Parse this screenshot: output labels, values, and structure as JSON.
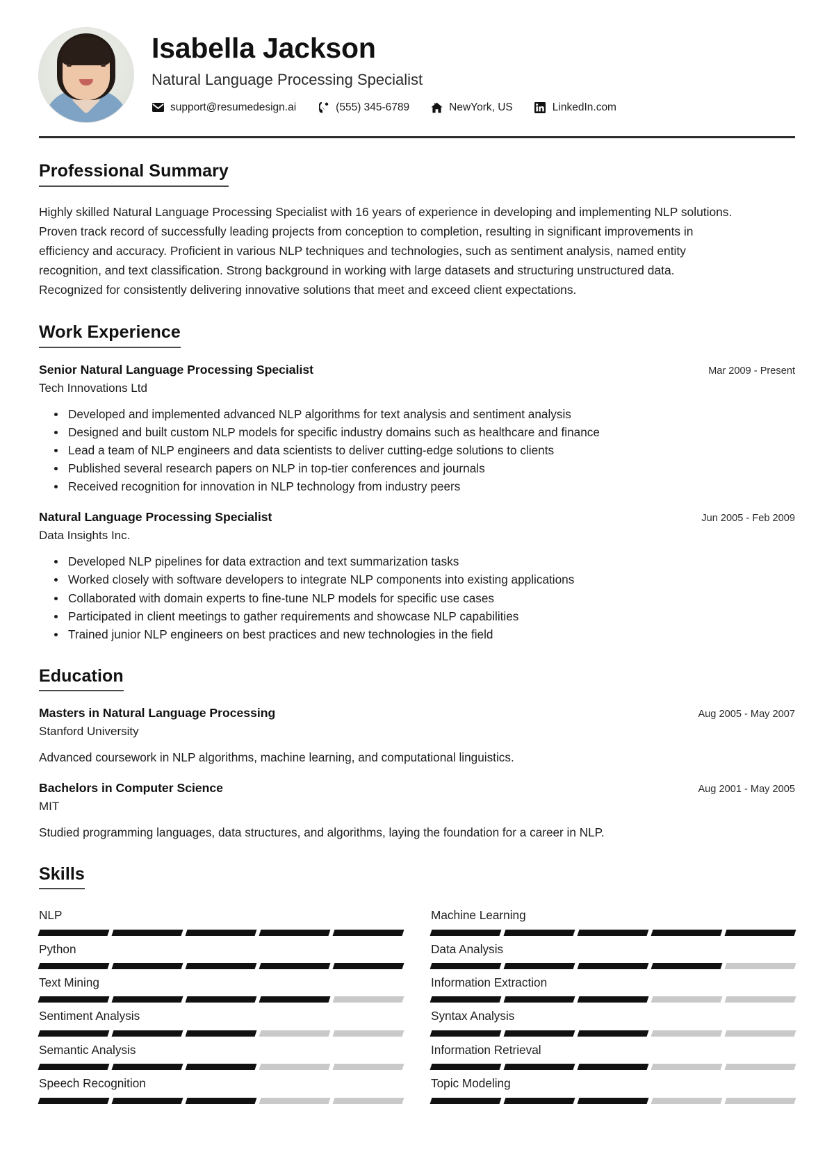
{
  "header": {
    "name": "Isabella Jackson",
    "job_title": "Natural Language Processing Specialist",
    "avatar_alt": "portrait-photo",
    "contacts": [
      {
        "icon": "envelope-icon",
        "label": "support@resumedesign.ai"
      },
      {
        "icon": "phone-icon",
        "label": "(555) 345-6789"
      },
      {
        "icon": "home-icon",
        "label": "NewYork, US"
      },
      {
        "icon": "linkedin-icon",
        "label": "LinkedIn.com"
      }
    ]
  },
  "summary": {
    "title": "Professional Summary",
    "text": "Highly skilled Natural Language Processing Specialist with 16 years of experience in developing and implementing NLP solutions. Proven track record of successfully leading projects from conception to completion, resulting in significant improvements in efficiency and accuracy. Proficient in various NLP techniques and technologies, such as sentiment analysis, named entity recognition, and text classification. Strong background in working with large datasets and structuring unstructured data. Recognized for consistently delivering innovative solutions that meet and exceed client expectations."
  },
  "work": {
    "title": "Work Experience",
    "entries": [
      {
        "title": "Senior Natural Language Processing Specialist",
        "company": "Tech Innovations Ltd",
        "date": "Mar 2009 - Present",
        "bullets": [
          "Developed and implemented advanced NLP algorithms for text analysis and sentiment analysis",
          "Designed and built custom NLP models for specific industry domains such as healthcare and finance",
          "Lead a team of NLP engineers and data scientists to deliver cutting-edge solutions to clients",
          "Published several research papers on NLP in top-tier conferences and journals",
          "Received recognition for innovation in NLP technology from industry peers"
        ]
      },
      {
        "title": "Natural Language Processing Specialist",
        "company": "Data Insights Inc.",
        "date": "Jun 2005 - Feb 2009",
        "bullets": [
          "Developed NLP pipelines for data extraction and text summarization tasks",
          "Worked closely with software developers to integrate NLP components into existing applications",
          "Collaborated with domain experts to fine-tune NLP models for specific use cases",
          "Participated in client meetings to gather requirements and showcase NLP capabilities",
          "Trained junior NLP engineers on best practices and new technologies in the field"
        ]
      }
    ]
  },
  "education": {
    "title": "Education",
    "entries": [
      {
        "degree": "Masters in Natural Language Processing",
        "school": "Stanford University",
        "date": "Aug 2005 - May 2007",
        "description": "Advanced coursework in NLP algorithms, machine learning, and computational linguistics."
      },
      {
        "degree": "Bachelors in Computer Science",
        "school": "MIT",
        "date": "Aug 2001 - May 2005",
        "description": "Studied programming languages, data structures, and algorithms, laying the foundation for a career in NLP."
      }
    ]
  },
  "skills": {
    "title": "Skills",
    "max_level": 5,
    "filled_color": "#111111",
    "empty_color": "#c9c9c9",
    "items": [
      {
        "name": "NLP",
        "level": 5
      },
      {
        "name": "Machine Learning",
        "level": 5
      },
      {
        "name": "Python",
        "level": 5
      },
      {
        "name": "Data Analysis",
        "level": 4
      },
      {
        "name": "Text Mining",
        "level": 4
      },
      {
        "name": "Information Extraction",
        "level": 3
      },
      {
        "name": "Sentiment Analysis",
        "level": 3
      },
      {
        "name": "Syntax Analysis",
        "level": 3
      },
      {
        "name": "Semantic Analysis",
        "level": 3
      },
      {
        "name": "Information Retrieval",
        "level": 3
      },
      {
        "name": "Speech Recognition",
        "level": 3
      },
      {
        "name": "Topic Modeling",
        "level": 3
      }
    ]
  }
}
